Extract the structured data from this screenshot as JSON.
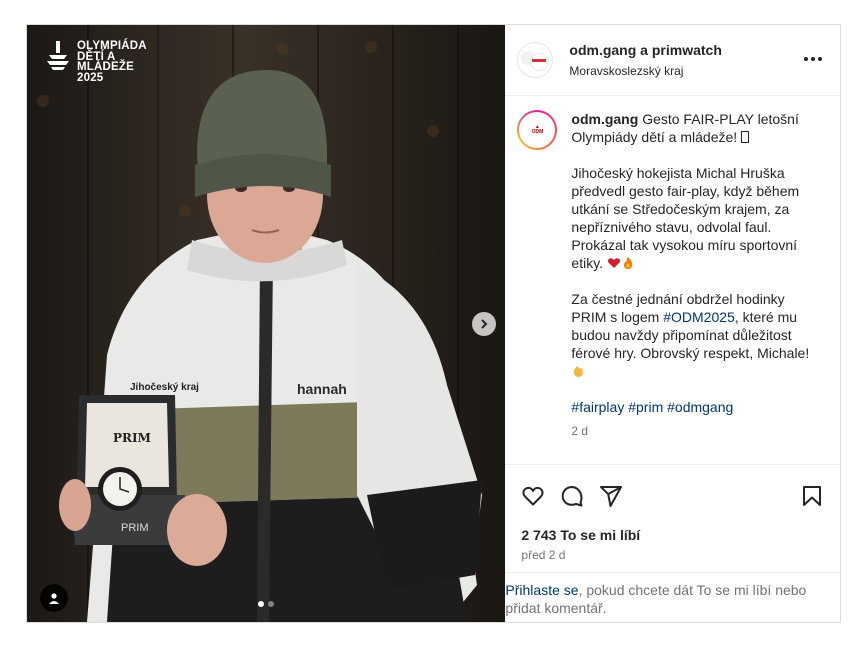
{
  "header": {
    "username": "odm.gang a primwatch",
    "location": "Moravskoslezský kraj"
  },
  "media": {
    "logo_lines": [
      "OLYMPIÁDA",
      "DĚTÍ A",
      "MLÁDEŽE",
      "2025"
    ],
    "jacket_text_left": "Jihočeský kraj",
    "jacket_text_right": "hannah",
    "box_brand": "PRIM",
    "carousel_count": 2,
    "carousel_active": 0
  },
  "caption": {
    "username": "odm.gang",
    "line1": "Gesto FAIR-PLAY letošní Olympiády dětí a mládeže!",
    "para2": "Jihočeský hokejista Michal Hruška předvedl gesto fair-play, když během utkání se Středočeským krajem, za nepříznivého stavu, odvolal faul. Prokázal tak vysokou míru sportovní etiky.",
    "para3_a": "Za čestné jednání obdržel hodinky PRIM s logem",
    "para3_tag": "#ODM2025",
    "para3_b": ", které mu budou navždy připomínat důležitost férové hry. Obrovský respekt, Michale!",
    "hashtags": [
      "#fairplay",
      "#prim",
      "#odmgang"
    ],
    "time": "2 d"
  },
  "icons": {
    "like": "heart-icon",
    "comment": "comment-icon",
    "share": "send-icon",
    "save": "bookmark-icon",
    "more": "more-icon",
    "next": "chevron-right-icon",
    "tag": "user-tag-icon"
  },
  "stats": {
    "likes": "2 743 To se mi líbí",
    "ago": "před 2 d"
  },
  "login": {
    "link": "Přihlaste se",
    "rest": ", pokud chcete dát To se mi líbí nebo přidat komentář."
  }
}
